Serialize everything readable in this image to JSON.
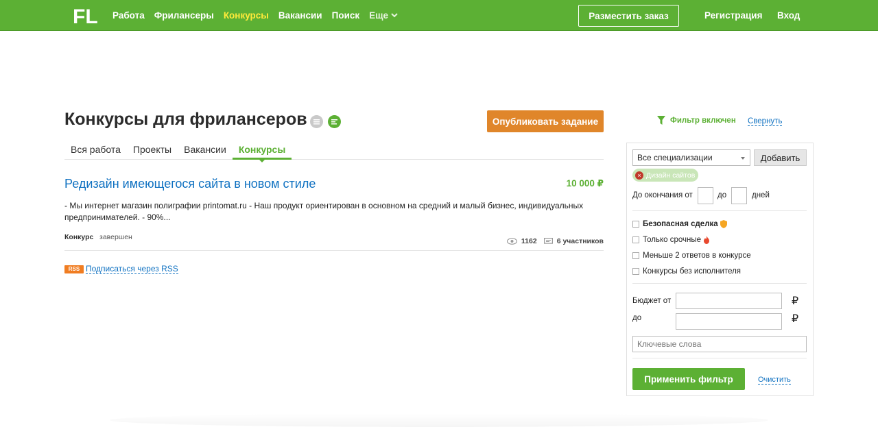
{
  "header": {
    "logo_text": "FL",
    "nav": [
      "Работа",
      "Фрилансеры",
      "Конкурсы",
      "Вакансии",
      "Поиск"
    ],
    "more_label": "Еще",
    "post_order_label": "Разместить заказ",
    "register_label": "Регистрация",
    "login_label": "Вход",
    "colors": {
      "brand": "#5cb034",
      "active_nav": "#ffea3a"
    }
  },
  "main": {
    "title": "Конкурсы для фрилансеров",
    "publish_label": "Опубликовать задание",
    "tabs": [
      "Вся работа",
      "Проекты",
      "Вакансии",
      "Конкурсы"
    ],
    "active_tab": "Конкурсы",
    "project": {
      "title": "Редизайн имеющегося сайта в новом стиле",
      "price": "10 000 ₽",
      "description": "-       Мы интернет магазин полиграфии printomat.ru -       Наш продукт ориентирован в основном на средний и малый бизнес, индивидуальных предпринимателей.  -       90%...",
      "type": "Конкурс",
      "status": "завершен",
      "views": "1162",
      "participants": "6 участников"
    },
    "rss_badge": "RSS",
    "rss_link": "Подписаться через RSS"
  },
  "filter": {
    "state_label": "Фильтр включен",
    "collapse_label": "Свернуть",
    "spec_select_value": "Все специализации",
    "add_label": "Добавить",
    "chip_label": "Дизайн сайтов",
    "deadline_label": "До окончания от",
    "deadline_to": "до",
    "days": "дней",
    "checks": [
      "Безопасная сделка",
      "Только срочные",
      "Меньше 2 ответов в конкурсе",
      "Конкурсы без исполнителя"
    ],
    "budget_from_label": "Бюджет от",
    "budget_to_label": "до",
    "currency": "₽",
    "keywords_placeholder": "Ключевые слова",
    "apply_label": "Применить фильтр",
    "clear_label": "Очистить"
  }
}
